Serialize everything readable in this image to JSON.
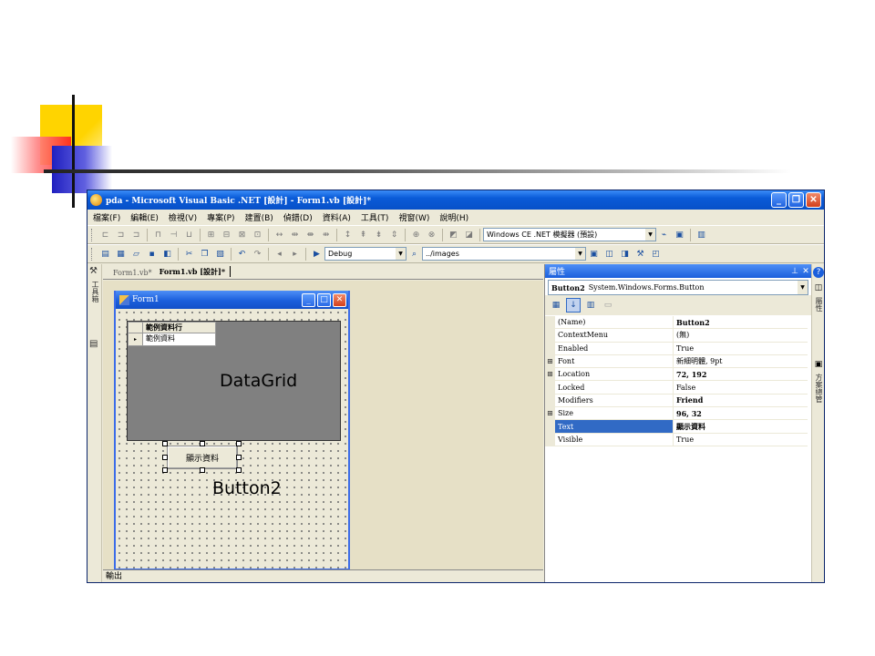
{
  "window": {
    "title": "pda - Microsoft Visual Basic .NET [設計] - Form1.vb [設計]*",
    "minimize": "_",
    "restore": "❐",
    "close": "✕"
  },
  "menu": [
    "檔案(F)",
    "編輯(E)",
    "檢視(V)",
    "專案(P)",
    "建置(B)",
    "偵錯(D)",
    "資料(A)",
    "工具(T)",
    "視窗(W)",
    "說明(H)"
  ],
  "toolbar": {
    "device_combo": "Windows CE .NET 模擬器 (預設)",
    "config_combo": "Debug",
    "path_combo": "../images"
  },
  "left_rail": {
    "toolbox_label": "工具箱"
  },
  "tabs": [
    {
      "label": "Form1.vb*",
      "active": false
    },
    {
      "label": "Form1.vb [設計]*",
      "active": true
    }
  ],
  "form": {
    "title": "Form1",
    "datagrid": {
      "column_header": "範例資料行",
      "row_indicator": "▸",
      "cell_value": "範例資料",
      "annotation": "DataGrid"
    },
    "button": {
      "label": "顯示資料",
      "annotation": "Button2"
    }
  },
  "output_bar": "輸出",
  "properties": {
    "title": "屬性",
    "pin": "⊥",
    "close": "✕",
    "object_name": "Button2",
    "object_type": "System.Windows.Forms.Button",
    "rows": [
      {
        "expand": "",
        "name": "(Name)",
        "value": "Button2",
        "bold": true,
        "selected": false
      },
      {
        "expand": "",
        "name": "ContextMenu",
        "value": "(無)",
        "bold": false,
        "selected": false
      },
      {
        "expand": "",
        "name": "Enabled",
        "value": "True",
        "bold": false,
        "selected": false
      },
      {
        "expand": "⊞",
        "name": "Font",
        "value": "新細明體, 9pt",
        "bold": false,
        "selected": false
      },
      {
        "expand": "⊞",
        "name": "Location",
        "value": "72, 192",
        "bold": true,
        "selected": false
      },
      {
        "expand": "",
        "name": "Locked",
        "value": "False",
        "bold": false,
        "selected": false
      },
      {
        "expand": "",
        "name": "Modifiers",
        "value": "Friend",
        "bold": true,
        "selected": false
      },
      {
        "expand": "⊞",
        "name": "Size",
        "value": "96, 32",
        "bold": true,
        "selected": false
      },
      {
        "expand": "",
        "name": "Text",
        "value": "顯示資料",
        "bold": true,
        "selected": true
      },
      {
        "expand": "",
        "name": "Visible",
        "value": "True",
        "bold": false,
        "selected": false
      }
    ]
  },
  "right_rail": {
    "properties_label": "屬性",
    "solution_label": "方案總管"
  },
  "colors": {
    "titlebar": "#0a5bd8",
    "selection": "#316ac5",
    "chrome": "#ece9d8"
  }
}
